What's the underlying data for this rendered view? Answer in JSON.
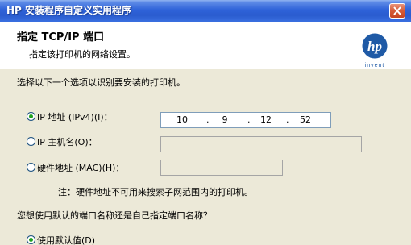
{
  "window": {
    "title": "HP 安装程序自定义实用程序"
  },
  "header": {
    "title": "指定 TCP/IP 端口",
    "subtitle": "指定该打印机的网络设置。",
    "logo_text": "hp",
    "logo_tagline": "invent"
  },
  "section1": {
    "instruction": "选择以下一个选项以识别要安装的打印机。",
    "options": [
      {
        "label": "IP 地址 (IPv4)(I)：",
        "checked": true
      },
      {
        "label": "IP 主机名(O)：",
        "checked": false
      },
      {
        "label": "硬件地址 (MAC)(H)：",
        "checked": false
      }
    ],
    "ip_parts": [
      "10",
      "9",
      "12",
      "52"
    ],
    "note": "注：硬件地址不可用来搜索子网范围内的打印机。"
  },
  "section2": {
    "question": "您想使用默认的端口名称还是自己指定端口名称？",
    "options": [
      {
        "label": "使用默认值(D)",
        "checked": true
      }
    ]
  },
  "colors": {
    "titlebar": "#2a5ccf",
    "dialog_bg": "#ece9d8",
    "radio_dot": "#21a121"
  }
}
